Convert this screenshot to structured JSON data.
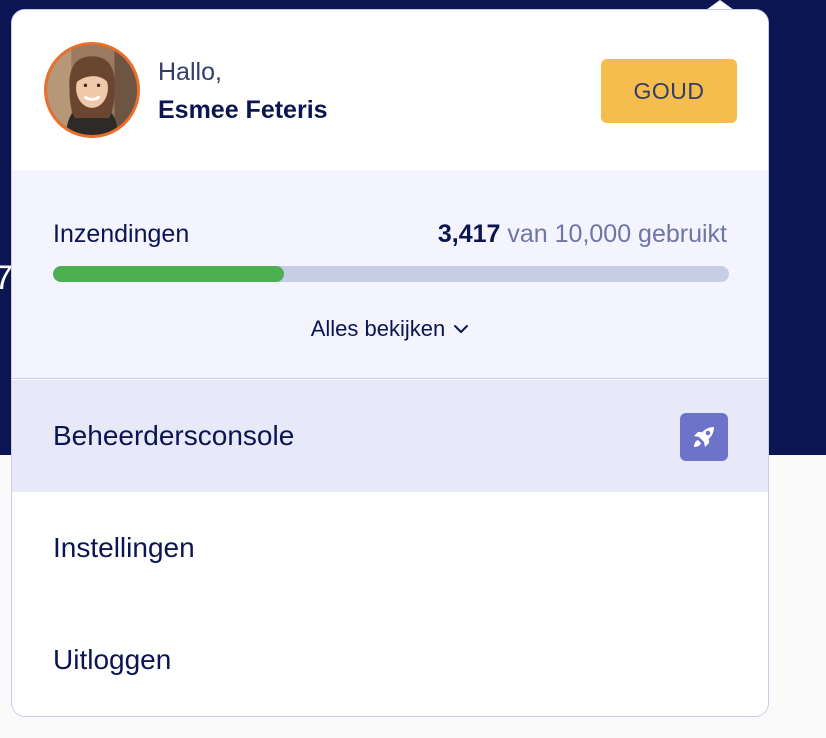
{
  "header": {
    "greeting": "Hallo,",
    "user_name": "Esmee Feteris",
    "plan_badge": "GOUD"
  },
  "usage": {
    "label": "Inzendingen",
    "used": "3,417",
    "total_text": "van 10,000 gebruikt",
    "progress_fraction": 0.3417,
    "view_all_label": "Alles bekijken"
  },
  "menu": {
    "admin_console": "Beheerdersconsole",
    "settings": "Instellingen",
    "logout": "Uitloggen"
  },
  "icons": {
    "admin": "rocket-icon",
    "view_all": "chevron-down-icon"
  },
  "colors": {
    "brand_navy": "#0a1551",
    "plan_gold": "#f5bd4b",
    "progress_green": "#4caf50",
    "avatar_ring": "#ea6f2b",
    "rocket_badge": "#6c73c9"
  }
}
